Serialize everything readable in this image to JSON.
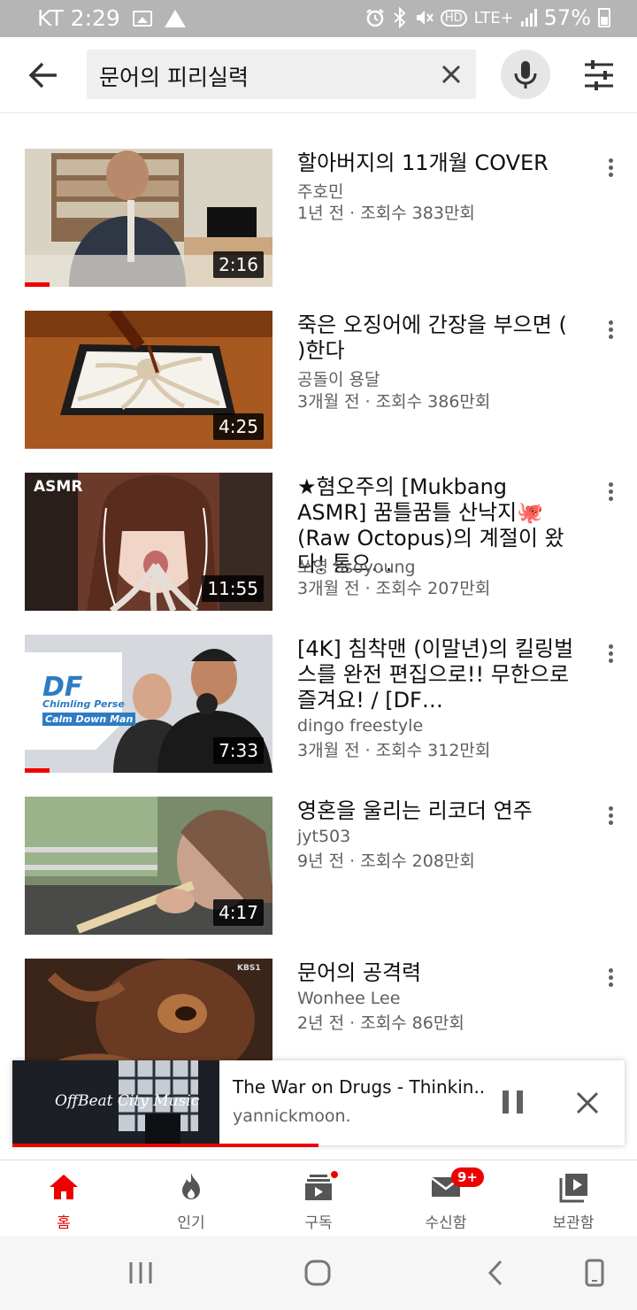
{
  "status_bar": {
    "carrier_time": "KT 2:29",
    "network": "LTE+",
    "battery": "57%",
    "icons": [
      "image-icon",
      "drive-icon",
      "alarm-icon",
      "bluetooth-icon",
      "mute-icon",
      "hd-icon",
      "signal-icon",
      "battery-icon"
    ]
  },
  "search": {
    "query": "문어의 피리실력"
  },
  "videos": [
    {
      "title": "할아버지의 11개월 COVER",
      "channel": "주호민",
      "meta": "1년 전 · 조회수 383만회",
      "duration": "2:16",
      "watched": 0.1,
      "thumb_tag": ""
    },
    {
      "title": "죽은 오징어에 간장을 부으면 (    )한다",
      "channel": "공돌이 용달",
      "meta": "3개월 전 · 조회수 386만회",
      "duration": "4:25",
      "watched": 0,
      "thumb_tag": ""
    },
    {
      "title": "★혐오주의 [Mukbang ASMR] 꿈틀꿈틀 산낙지🐙(Raw Octopus)의 계절이 왔다! 통으…",
      "channel": "쏘영 Ssoyoung",
      "meta": "3개월 전 · 조회수 207만회",
      "duration": "11:55",
      "watched": 0,
      "thumb_tag": "ASMR"
    },
    {
      "title": "[4K] 침착맨 (이말년)의 킬링벌스를 완전 편집으로!! 무한으로 즐겨요! / [DF…",
      "channel": "dingo freestyle",
      "meta": "3개월 전 · 조회수 312만회",
      "duration": "7:33",
      "watched": 0.1,
      "thumb_tag": ""
    },
    {
      "title": "영혼을 울리는 리코더 연주",
      "channel": "jyt503",
      "meta": "9년 전 · 조회수 208만회",
      "duration": "4:17",
      "watched": 0,
      "thumb_tag": ""
    },
    {
      "title": "문어의 공격력",
      "channel": "Wonhee Lee",
      "meta": "2년 전 · 조회수 86만회",
      "duration": "",
      "watched": 0,
      "thumb_tag": ""
    }
  ],
  "thumb_text": {
    "df_logo": "DF",
    "df_sub1": "Chimling Perse",
    "df_sub2": "Calm Down Man",
    "kbs": "KBS1"
  },
  "mini_player": {
    "title": "The War on Drugs - Thinkin..",
    "channel": "yannickmoon.",
    "thumb_text": "OffBeat City Music",
    "progress": 0.5
  },
  "bottom_nav": {
    "items": [
      {
        "label": "홈",
        "icon": "home-icon",
        "active": true
      },
      {
        "label": "인기",
        "icon": "fire-icon",
        "active": false
      },
      {
        "label": "구독",
        "icon": "subscriptions-icon",
        "active": false
      },
      {
        "label": "수신함",
        "icon": "inbox-icon",
        "active": false
      },
      {
        "label": "보관함",
        "icon": "library-icon",
        "active": false
      }
    ],
    "inbox_badge": "9+"
  },
  "colors": {
    "accent": "#ee0000",
    "status_bar_bg": "#b5b5b5",
    "secondary_text": "#606060"
  }
}
